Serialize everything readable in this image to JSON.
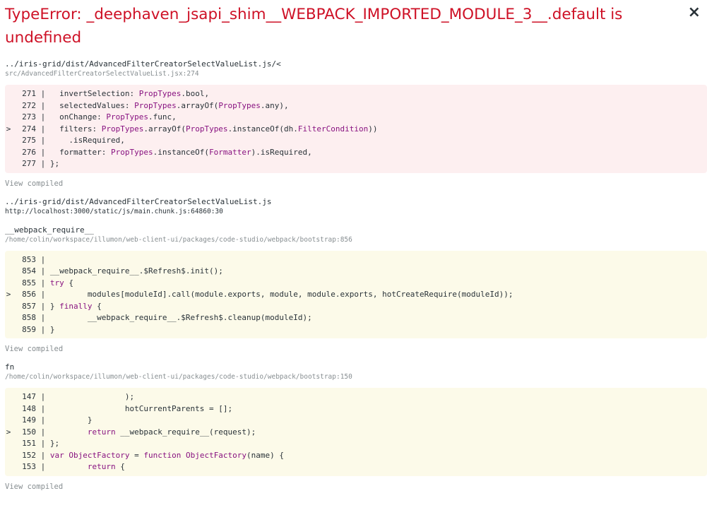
{
  "header": {
    "title": "TypeError: _deephaven_jsapi_shim__WEBPACK_IMPORTED_MODULE_3__.default is undefined",
    "close": "×"
  },
  "frames": [
    {
      "fn": "../iris-grid/dist/AdvancedFilterCreatorSelectValueList.js/<",
      "loc": "src/AdvancedFilterCreatorSelectValueList.jsx:274",
      "bg": "#fdeff0",
      "lines": [
        {
          "n": "271",
          "active": false,
          "html": "  invertSelection: <span class='k'>PropTypes</span>.bool,"
        },
        {
          "n": "272",
          "active": false,
          "html": "  selectedValues: <span class='k'>PropTypes</span>.arrayOf(<span class='k'>PropTypes</span>.any),"
        },
        {
          "n": "273",
          "active": false,
          "html": "  onChange: <span class='k'>PropTypes</span>.func,"
        },
        {
          "n": "274",
          "active": true,
          "html": "  filters: <span class='k'>PropTypes</span>.arrayOf(<span class='k'>PropTypes</span>.instanceOf(dh.<span class='k'>FilterCondition</span>))"
        },
        {
          "n": "275",
          "active": false,
          "html": "    .isRequired,"
        },
        {
          "n": "276",
          "active": false,
          "html": "  formatter: <span class='k'>PropTypes</span>.instanceOf(<span class='k'>Formatter</span>).isRequired,"
        },
        {
          "n": "277",
          "active": false,
          "html": "};"
        }
      ],
      "view": "View compiled"
    },
    {
      "fn": "../iris-grid/dist/AdvancedFilterCreatorSelectValueList.js",
      "loc": "http://localhost:3000/static/js/main.chunk.js:64860:30",
      "loc_dark": true
    },
    {
      "fn": "__webpack_require__",
      "loc": "/home/colin/workspace/illumon/web-client-ui/packages/code-studio/webpack/bootstrap:856",
      "bg": "#fcfae9",
      "lines": [
        {
          "n": "853",
          "active": false,
          "html": ""
        },
        {
          "n": "854",
          "active": false,
          "html": "__webpack_require__.$Refresh$.init();"
        },
        {
          "n": "855",
          "active": false,
          "html": "<span class='k'>try</span> {"
        },
        {
          "n": "856",
          "active": true,
          "html": "        modules[moduleId].call(module.exports, module, module.exports, hotCreateRequire(moduleId));"
        },
        {
          "n": "857",
          "active": false,
          "html": "} <span class='k'>finally</span> {"
        },
        {
          "n": "858",
          "active": false,
          "html": "        __webpack_require__.$Refresh$.cleanup(moduleId);"
        },
        {
          "n": "859",
          "active": false,
          "html": "}"
        }
      ],
      "view": "View compiled"
    },
    {
      "fn": "fn",
      "loc": "/home/colin/workspace/illumon/web-client-ui/packages/code-studio/webpack/bootstrap:150",
      "bg": "#fcfae9",
      "lines": [
        {
          "n": "147",
          "active": false,
          "html": "                );"
        },
        {
          "n": "148",
          "active": false,
          "html": "                hotCurrentParents = [];"
        },
        {
          "n": "149",
          "active": false,
          "html": "        }"
        },
        {
          "n": "150",
          "active": true,
          "html": "        <span class='k'>return</span> __webpack_require__(request);"
        },
        {
          "n": "151",
          "active": false,
          "html": "};"
        },
        {
          "n": "152",
          "active": false,
          "html": "<span class='k'>var</span> <span class='k'>ObjectFactory</span> = <span class='k'>function</span> <span class='k'>ObjectFactory</span>(name) {"
        },
        {
          "n": "153",
          "active": false,
          "html": "        <span class='k'>return</span> {"
        }
      ],
      "view": "View compiled"
    }
  ]
}
